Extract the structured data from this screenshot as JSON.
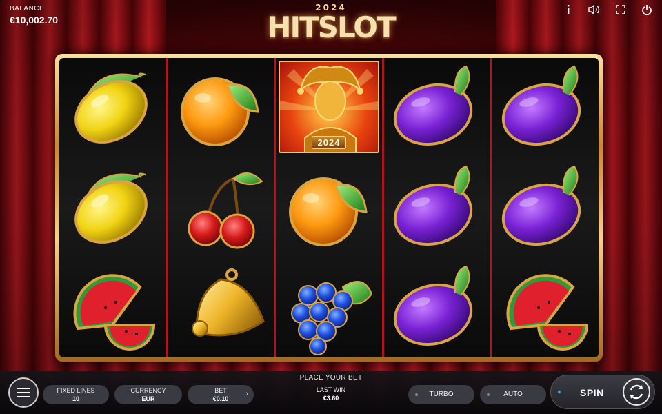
{
  "balance": {
    "label": "BALANCE",
    "value": "€10,002.70"
  },
  "logo": {
    "year": "2024",
    "name_left": "HIT",
    "name_right": "SLOT"
  },
  "top_icons": [
    "info-icon",
    "sound-icon",
    "fullscreen-icon",
    "power-icon"
  ],
  "reels": [
    [
      "lemon",
      "lemon",
      "watermelon"
    ],
    [
      "orange",
      "cherry",
      "bell"
    ],
    [
      "jester",
      "orange",
      "grapes"
    ],
    [
      "plum",
      "plum",
      "plum"
    ],
    [
      "plum",
      "plum",
      "watermelon"
    ]
  ],
  "jester_badge": "2024",
  "bottom": {
    "place_bet": "PLACE YOUR BET",
    "fixed_lines": {
      "label": "FIXED LINES",
      "value": "10"
    },
    "currency": {
      "label": "CURRENCY",
      "value": "EUR"
    },
    "bet": {
      "label": "BET",
      "value": "€0.10",
      "arrow": "›"
    },
    "last_win": {
      "label": "LAST WIN",
      "value": "€3.60"
    },
    "turbo": "TURBO",
    "auto": "AUTO",
    "spin": "SPIN"
  },
  "colors": {
    "curtain": "#b5121b",
    "gold": "#e3b55a",
    "accent_blue": "#29a9e0"
  }
}
